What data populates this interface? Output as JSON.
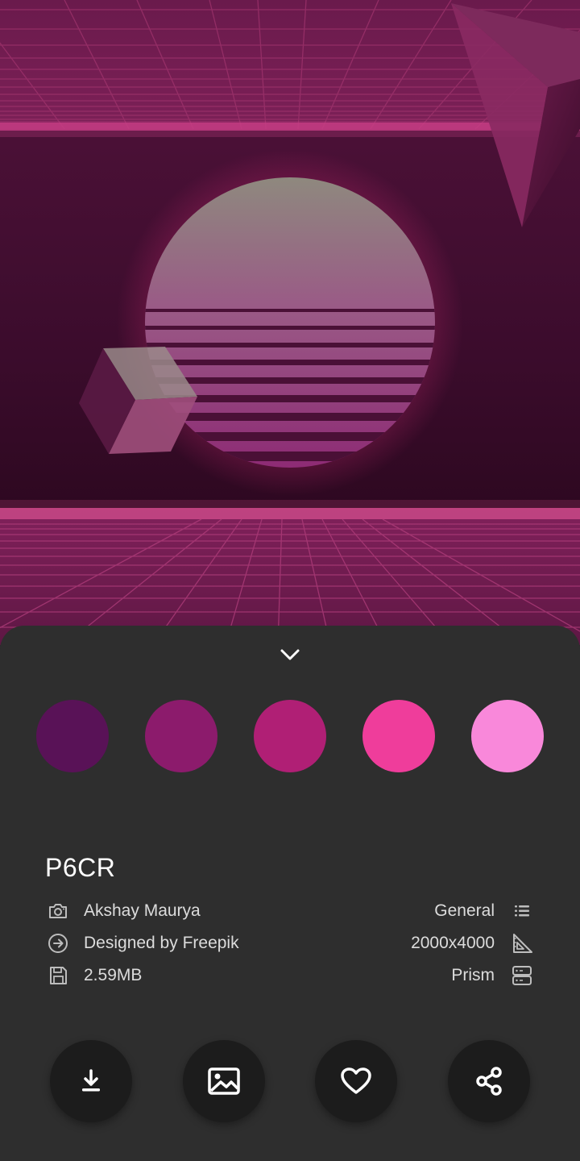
{
  "wallpaper": {
    "name": "P6CR",
    "palette": [
      "#591257",
      "#8c1b6c",
      "#b01f75",
      "#ef3d9b",
      "#f988da"
    ]
  },
  "details": {
    "author": "Akshay Maurya",
    "credit": "Designed by Freepik",
    "file_size": "2.59MB",
    "category": "General",
    "resolution": "2000x4000",
    "collection": "Prism"
  },
  "icons": {
    "collapse": "chevron-down-icon",
    "author": "camera-icon",
    "credit": "arrow-circle-right-icon",
    "file_size": "save-icon",
    "category": "list-icon",
    "resolution": "set-square-icon",
    "collection": "storage-icon",
    "download": "download-icon",
    "set_wallpaper": "image-icon",
    "favorite": "heart-icon",
    "share": "share-icon"
  }
}
